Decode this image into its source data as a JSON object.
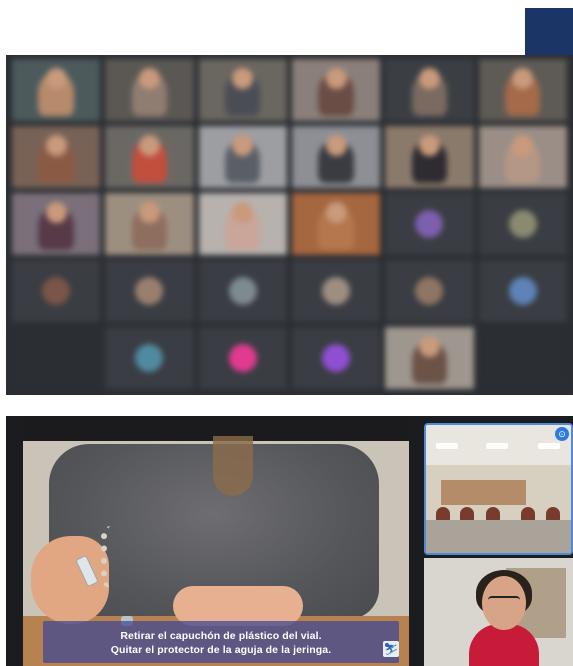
{
  "colors": {
    "grid_background": "#2b2e33",
    "tile_background": "#3a3d43",
    "corner_block": "#1b3566",
    "active_speaker_border": "#4f8ad8",
    "subtitle_background": "#3a4696"
  },
  "meeting_grid": {
    "rows": [
      [
        {
          "kind": "video",
          "shirt": "#b68a6a",
          "bg": "#4c5a5c"
        },
        {
          "kind": "video",
          "shirt": "#8f7d71",
          "bg": "#5b5854"
        },
        {
          "kind": "video",
          "shirt": "#4b4d55",
          "bg": "#6a6660"
        },
        {
          "kind": "video",
          "shirt": "#6a4d45",
          "bg": "#8a7f7a"
        },
        {
          "kind": "video",
          "shirt": "#7a6a60",
          "bg": "#3b3f44"
        },
        {
          "kind": "video",
          "shirt": "#a46a4a",
          "bg": "#5e5a55"
        }
      ],
      [
        {
          "kind": "video",
          "shirt": "#8b5a45",
          "bg": "#786256"
        },
        {
          "kind": "video",
          "shirt": "#c24e3e",
          "bg": "#6b6864"
        },
        {
          "kind": "video",
          "shirt": "#5a5f66",
          "bg": "#9c9ea2"
        },
        {
          "kind": "video",
          "shirt": "#3a3c42",
          "bg": "#8d8f95"
        },
        {
          "kind": "video",
          "shirt": "#2e2c30",
          "bg": "#8a7a6b"
        },
        {
          "kind": "video",
          "shirt": "#b59785",
          "bg": "#9a8e86"
        }
      ],
      [
        {
          "kind": "video",
          "shirt": "#573a48",
          "bg": "#7a6f7a"
        },
        {
          "kind": "video",
          "shirt": "#8e6e5e",
          "bg": "#9d8f80"
        },
        {
          "kind": "video",
          "shirt": "#c9a59a",
          "bg": "#b7b2ae"
        },
        {
          "kind": "video",
          "shirt": "#b5774c",
          "bg": "#a5673f"
        },
        {
          "kind": "audio",
          "avatar": "#7d5fae"
        },
        {
          "kind": "audio",
          "avatar": "#8a8a70"
        }
      ],
      [
        {
          "kind": "audio",
          "avatar": "#7b5547"
        },
        {
          "kind": "audio",
          "avatar": "#9a7f6f"
        },
        {
          "kind": "audio",
          "avatar": "#7d8a8e"
        },
        {
          "kind": "audio",
          "avatar": "#9d8e7f"
        },
        {
          "kind": "audio",
          "avatar": "#8f7563"
        },
        {
          "kind": "audio",
          "avatar": "#5d83b7"
        }
      ],
      [
        {
          "kind": "empty"
        },
        {
          "kind": "audio",
          "avatar": "#4f8aa0"
        },
        {
          "kind": "audio",
          "avatar": "#e03b8f"
        },
        {
          "kind": "audio",
          "avatar": "#8f4fd2"
        },
        {
          "kind": "video",
          "shirt": "#6b5348",
          "bg": "#9e978f"
        },
        {
          "kind": "empty"
        }
      ]
    ]
  },
  "class_video": {
    "subtitle_line1": "Retirar el capuchón de plástico del vial.",
    "subtitle_line2": "Quitar el protector de la aguja de la jeringa.",
    "pin_icon": "pin-icon",
    "logo_icon": "broadcaster-logo-icon"
  }
}
